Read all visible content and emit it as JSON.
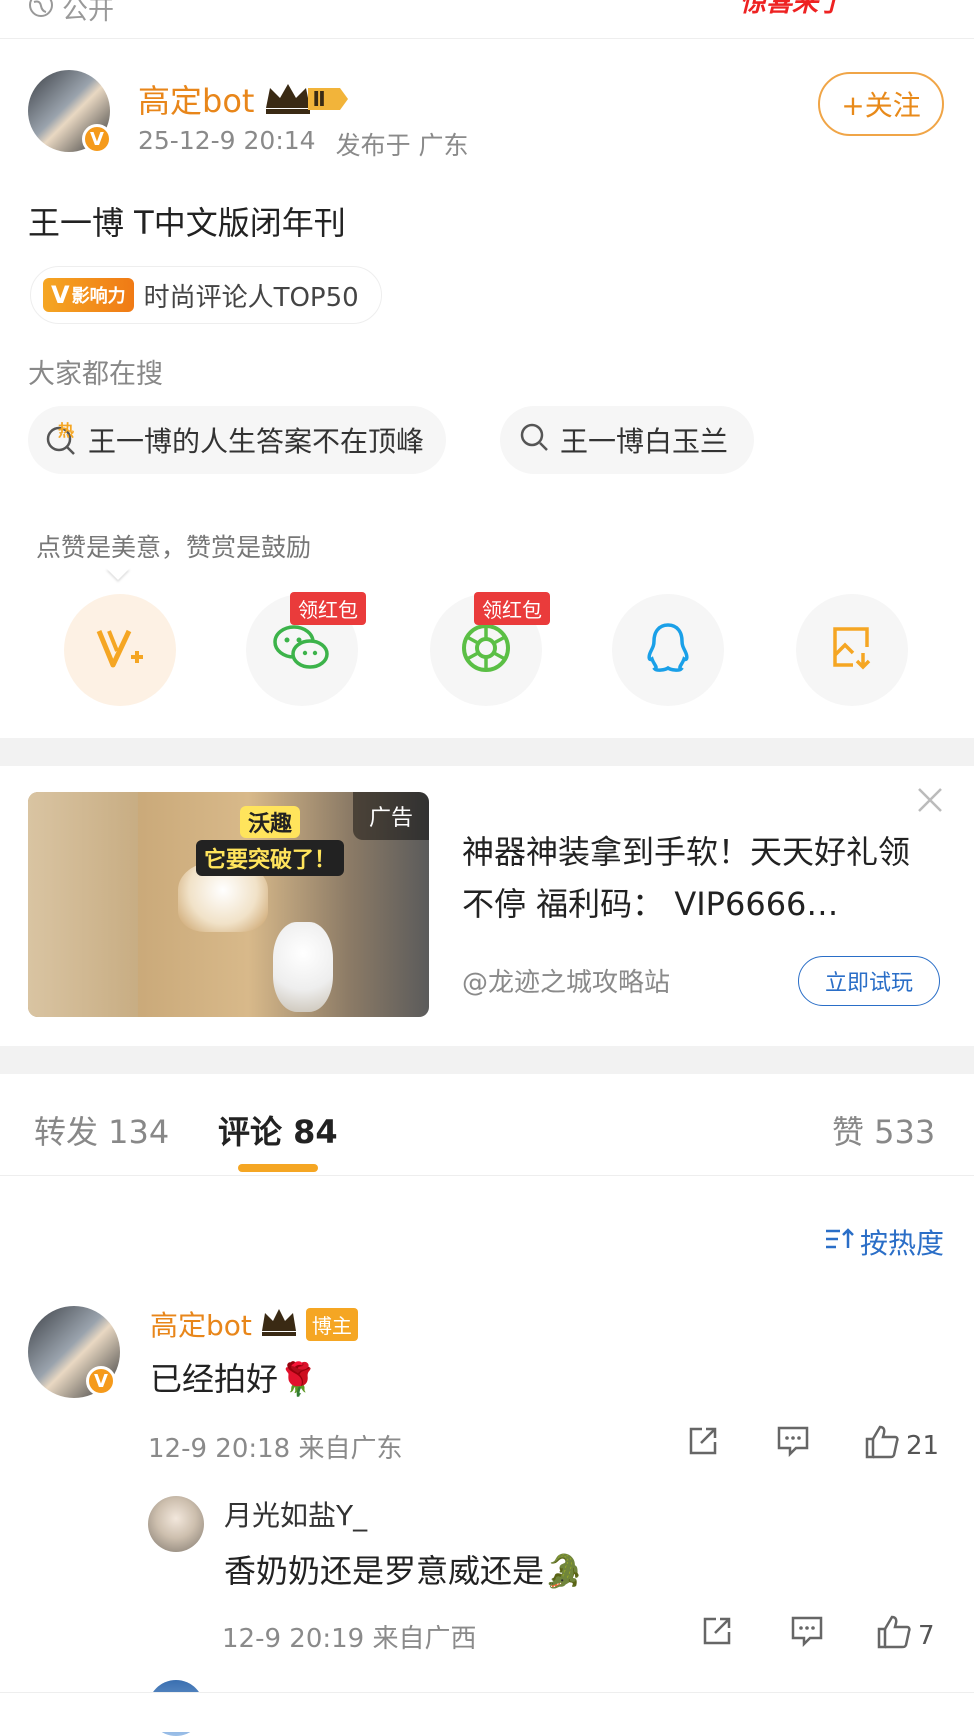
{
  "top": {
    "visibility": "公开",
    "promo_text": "惊喜来了"
  },
  "post": {
    "author": "高定bot",
    "level": "Ⅱ",
    "time": "25-12-9 20:14",
    "location": "发布于 广东",
    "follow_label": "+关注",
    "text": "王一博 T中文版闭年刊",
    "influence_tag": "影响力",
    "influence_text": "时尚评论人TOP50"
  },
  "search": {
    "title": "大家都在搜",
    "items": [
      {
        "icon": "hot-search-icon",
        "hot_label": "热",
        "label": "王一博的人生答案不在顶峰"
      },
      {
        "icon": "search-icon",
        "label": "王一博白玉兰"
      }
    ]
  },
  "reward": {
    "hint": "点赞是美意，赞赏是鼓励",
    "buttons": [
      {
        "icon": "reward-v-icon"
      },
      {
        "icon": "wechat-icon",
        "tag": "领红包"
      },
      {
        "icon": "moments-icon",
        "tag": "领红包"
      },
      {
        "icon": "qq-icon"
      },
      {
        "icon": "save-image-icon"
      }
    ]
  },
  "ad": {
    "label": "广告",
    "bubble_line1": "沃趣",
    "bubble_line2": "它要突破了！",
    "title": "神器神装拿到手软！天天好礼领不停 福利码： VIP6666…",
    "source": "@龙迹之城攻略站",
    "cta": "立即试玩"
  },
  "tabs": {
    "forward": "转发 134",
    "comments": "评论 84",
    "likes": "赞 533"
  },
  "sort_label": "按热度",
  "comments": [
    {
      "name": "高定bot",
      "role": "博主",
      "text": "已经拍好🌹",
      "meta": "12-9 20:18 来自广东",
      "likes": "21"
    },
    {
      "name": "月光如盐Y_",
      "text": "香奶奶还是罗意威还是🐊",
      "meta": "12-9 20:19 来自广西",
      "likes": "7"
    }
  ],
  "colors": {
    "accent": "#e8861a",
    "link": "#2a6ec7",
    "red_tag": "#ea3b3b"
  }
}
